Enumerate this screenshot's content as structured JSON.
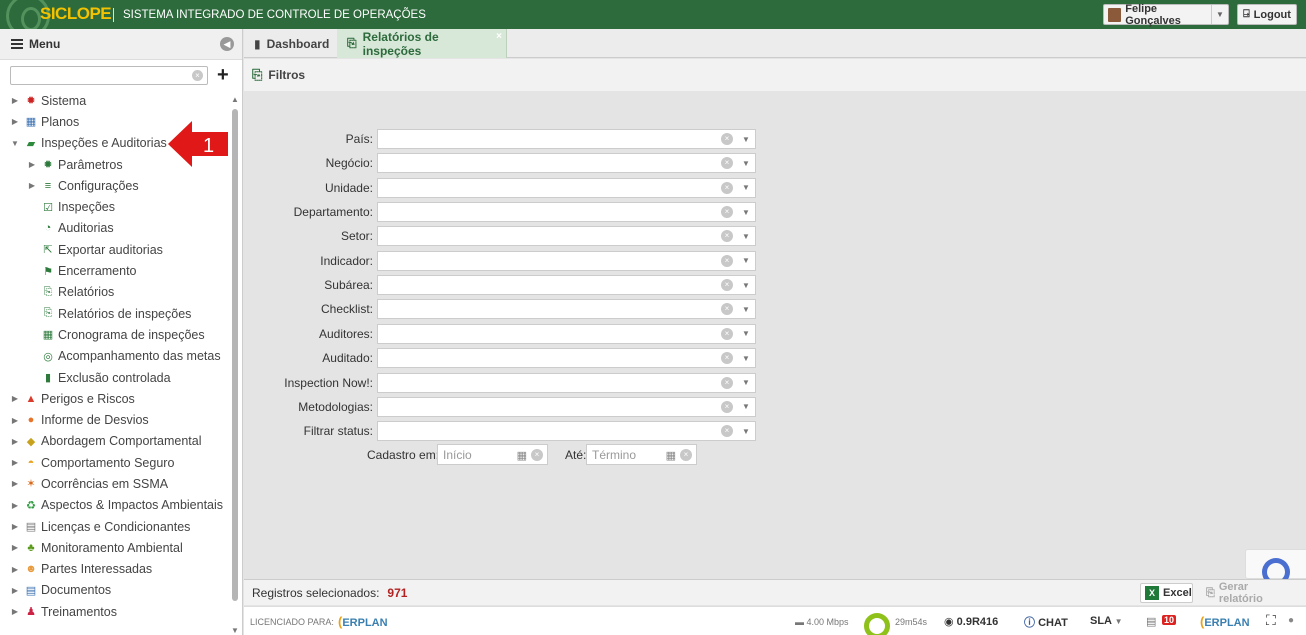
{
  "app": {
    "brand": "SICLOPE",
    "subtitle": "SISTEMA INTEGRADO DE CONTROLE DE OPERAÇÕES",
    "user_name": "Felipe Gonçalves",
    "logout_label": "Logout",
    "colors": {
      "header": "#2d6a3c",
      "brand": "#f3c200",
      "accent": "#2d6a3c",
      "count": "#b22222"
    }
  },
  "sidebar": {
    "title": "Menu",
    "search_placeholder": "",
    "items": [
      {
        "label": "Sistema",
        "level": 0,
        "icon": "gear-icon",
        "color": "#cc2222",
        "glyph": "✹",
        "arrow": "▶"
      },
      {
        "label": "Planos",
        "level": 0,
        "icon": "calendar-icon",
        "color": "#3a6fb0",
        "glyph": "▦",
        "arrow": "▶"
      },
      {
        "label": "Inspeções e Auditorias",
        "level": 0,
        "icon": "folder-icon",
        "color": "#2d8a3c",
        "glyph": "▰",
        "arrow": "▼"
      },
      {
        "label": "Parâmetros",
        "level": 1,
        "icon": "settings-icon",
        "color": "#2d7a3c",
        "glyph": "✹",
        "arrow": "▶"
      },
      {
        "label": "Configurações",
        "level": 1,
        "icon": "sliders-icon",
        "color": "#2d7a3c",
        "glyph": "≡",
        "arrow": "▶"
      },
      {
        "label": "Inspeções",
        "level": 1,
        "icon": "checklist-icon",
        "color": "#2d7a3c",
        "glyph": "☑",
        "arrow": ""
      },
      {
        "label": "Auditorias",
        "level": 1,
        "icon": "audit-icon",
        "color": "#2d7a3c",
        "glyph": "◔",
        "arrow": ""
      },
      {
        "label": "Exportar auditorias",
        "level": 1,
        "icon": "export-icon",
        "color": "#2d7a3c",
        "glyph": "⇱",
        "arrow": ""
      },
      {
        "label": "Encerramento",
        "level": 1,
        "icon": "flag-icon",
        "color": "#2d7a3c",
        "glyph": "⚑",
        "arrow": ""
      },
      {
        "label": "Relatórios",
        "level": 1,
        "icon": "pdf-icon",
        "color": "#2d7a3c",
        "glyph": "⎘",
        "arrow": ""
      },
      {
        "label": "Relatórios de inspeções",
        "level": 1,
        "icon": "pdf-icon",
        "color": "#2d7a3c",
        "glyph": "⎘",
        "arrow": ""
      },
      {
        "label": "Cronograma de inspeções",
        "level": 1,
        "icon": "schedule-icon",
        "color": "#2d7a3c",
        "glyph": "▦",
        "arrow": ""
      },
      {
        "label": "Acompanhamento das metas",
        "level": 1,
        "icon": "target-icon",
        "color": "#2d7a3c",
        "glyph": "◎",
        "arrow": ""
      },
      {
        "label": "Exclusão controlada",
        "level": 1,
        "icon": "trash-icon",
        "color": "#2d7a3c",
        "glyph": "▮",
        "arrow": ""
      },
      {
        "label": "Perigos e Riscos",
        "level": 0,
        "icon": "warning-icon",
        "color": "#d93a2a",
        "glyph": "▲",
        "arrow": "▶"
      },
      {
        "label": "Informe de Desvios",
        "level": 0,
        "icon": "phone-icon",
        "color": "#e8742a",
        "glyph": "●",
        "arrow": "▶"
      },
      {
        "label": "Abordagem Comportamental",
        "level": 0,
        "icon": "diamond-icon",
        "color": "#c8a21c",
        "glyph": "◆",
        "arrow": "▶"
      },
      {
        "label": "Comportamento Seguro",
        "level": 0,
        "icon": "helmet-icon",
        "color": "#e8a21c",
        "glyph": "◓",
        "arrow": "▶"
      },
      {
        "label": "Ocorrências em SSMA",
        "level": 0,
        "icon": "accident-icon",
        "color": "#d86a1c",
        "glyph": "✶",
        "arrow": "▶"
      },
      {
        "label": "Aspectos & Impactos Ambientais",
        "level": 0,
        "icon": "recycle-icon",
        "color": "#2d9a3c",
        "glyph": "♻",
        "arrow": "▶"
      },
      {
        "label": "Licenças e Condicionantes",
        "level": 0,
        "icon": "document-icon",
        "color": "#777777",
        "glyph": "▤",
        "arrow": "▶"
      },
      {
        "label": "Monitoramento Ambiental",
        "level": 0,
        "icon": "tree-icon",
        "color": "#5a9a1c",
        "glyph": "♣",
        "arrow": "▶"
      },
      {
        "label": "Partes Interessadas",
        "level": 0,
        "icon": "people-icon",
        "color": "#e89a3c",
        "glyph": "☻",
        "arrow": "▶"
      },
      {
        "label": "Documentos",
        "level": 0,
        "icon": "docs-icon",
        "color": "#3a6fb0",
        "glyph": "▤",
        "arrow": "▶"
      },
      {
        "label": "Treinamentos",
        "level": 0,
        "icon": "trainer-icon",
        "color": "#cc2244",
        "glyph": "♟",
        "arrow": "▶"
      }
    ]
  },
  "annotation": {
    "number": "1"
  },
  "tabs": {
    "dashboard": "Dashboard",
    "active": "Relatórios de inspeções",
    "close": "×"
  },
  "filters": {
    "title": "Filtros",
    "fields": [
      "País:",
      "Negócio:",
      "Unidade:",
      "Departamento:",
      "Setor:",
      "Indicador:",
      "Subárea:",
      "Checklist:",
      "Auditores:",
      "Auditado:",
      "Inspection Now!:",
      "Metodologias:",
      "Filtrar status:"
    ],
    "cadastro_label": "Cadastro em:",
    "start_placeholder": "Início",
    "ate_label": "Até:",
    "end_placeholder": "Término"
  },
  "footer": {
    "selected_label": "Registros selecionados:",
    "selected_count": "971",
    "excel_label": "Excel",
    "report_label": "Gerar relatório"
  },
  "statusbar": {
    "licensed_label": "LICENCIADO PARA:",
    "erplan": "ERPLAN",
    "speed": "4.00 Mbps",
    "timer": "29m54s",
    "version": "0.9R416",
    "chat": "CHAT",
    "sla": "SLA",
    "notif_count": "10"
  }
}
